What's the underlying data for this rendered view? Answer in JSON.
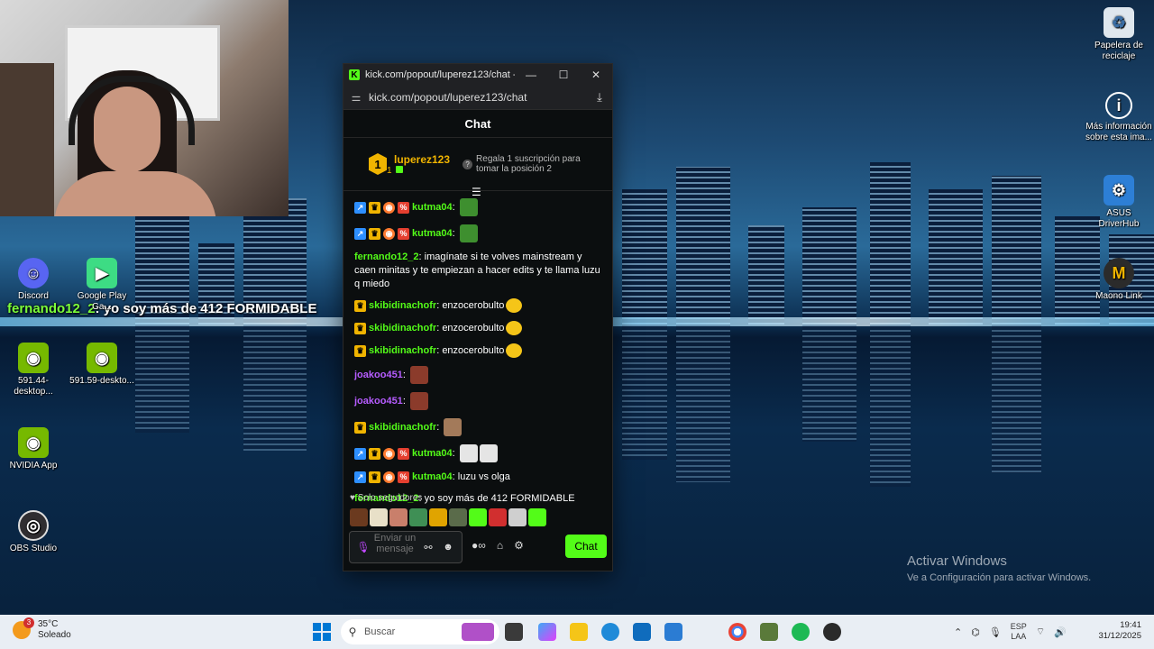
{
  "desktop": {
    "icons": [
      {
        "label": "Papelera de reciclaje",
        "icon": "recycle-bin-icon"
      },
      {
        "label": "Más información sobre esta ima...",
        "icon": "info-icon"
      },
      {
        "label": "ASUS DriverHub",
        "icon": "asus-icon"
      },
      {
        "label": "Maono Link",
        "icon": "maono-icon"
      },
      {
        "label": "Discord",
        "icon": "discord-icon"
      },
      {
        "label": "Google Play Ga...",
        "icon": "google-play-icon"
      },
      {
        "label": "591.44-desktop...",
        "icon": "nvidia-installer-icon"
      },
      {
        "label": "591.59-deskto...",
        "icon": "nvidia-installer-icon"
      },
      {
        "label": "NVIDIA App",
        "icon": "nvidia-icon"
      },
      {
        "label": "OBS Studio",
        "icon": "obs-icon"
      }
    ],
    "overlay": {
      "name": "fernando12_2",
      "text": ": yo soy más de 412 FORMIDABLE"
    },
    "activate": {
      "title": "Activar Windows",
      "subtitle": "Ve a Configuración para activar Windows."
    }
  },
  "window": {
    "title": "kick.com/popout/luperez123/chat - G...",
    "url": "kick.com/popout/luperez123/chat",
    "chat_header": "Chat",
    "pinned": {
      "rank": "1",
      "user": "luperez123",
      "count": "1",
      "info": "Regala 1 suscripción para tomar la posición 2"
    },
    "messages": [
      {
        "badges": [
          "mod",
          "vip",
          "og",
          "sub"
        ],
        "user": "kutma04",
        "color": "#53fc18",
        "text": "",
        "emotes": [
          "e-green"
        ]
      },
      {
        "badges": [
          "mod",
          "vip",
          "og",
          "sub"
        ],
        "user": "kutma04",
        "color": "#53fc18",
        "text": "",
        "emotes": [
          "e-green"
        ]
      },
      {
        "badges": [],
        "user": "fernando12_2",
        "color": "#53fc18",
        "text": "imagínate si te volves mainstream y caen minitas y te empiezan a hacer edits y te llama luzu q miedo",
        "emotes": [],
        "multi": true
      },
      {
        "badges": [
          "vip"
        ],
        "user": "skibidinachofr",
        "color": "#53fc18",
        "text": "enzocerobulto",
        "emotes": [
          "e-yellow"
        ]
      },
      {
        "badges": [
          "vip"
        ],
        "user": "skibidinachofr",
        "color": "#53fc18",
        "text": "enzocerobulto",
        "emotes": [
          "e-yellow"
        ]
      },
      {
        "badges": [
          "vip"
        ],
        "user": "skibidinachofr",
        "color": "#53fc18",
        "text": "enzocerobulto",
        "emotes": [
          "e-yellow"
        ]
      },
      {
        "badges": [],
        "user": "joakoo451",
        "color": "#b65cff",
        "text": "",
        "emotes": [
          "e-face"
        ]
      },
      {
        "badges": [],
        "user": "joakoo451",
        "color": "#b65cff",
        "text": "",
        "emotes": [
          "e-face"
        ]
      },
      {
        "badges": [
          "vip"
        ],
        "user": "skibidinachofr",
        "color": "#53fc18",
        "text": "",
        "emotes": [
          "e-photo"
        ]
      },
      {
        "badges": [
          "mod",
          "vip",
          "og",
          "sub"
        ],
        "user": "kutma04",
        "color": "#53fc18",
        "text": "",
        "emotes": [
          "e-white",
          "e-white"
        ]
      },
      {
        "badges": [
          "mod",
          "vip",
          "og",
          "sub"
        ],
        "user": "kutma04",
        "color": "#53fc18",
        "text": "luzu vs olga",
        "emotes": []
      },
      {
        "badges": [],
        "user": "fernando12_2",
        "color": "#53fc18",
        "text": "yo soy más de 412 FORMIDABLE",
        "emotes": []
      }
    ],
    "followers_only": "Solo seguidores",
    "emote_bar_colors": [
      "#6b3a1f",
      "#e8e0c8",
      "#c97f6b",
      "#3f8f55",
      "#e0a400",
      "#5a6b4a",
      "#53fc18",
      "#d12f2f",
      "#cfcfcf",
      "#53fc18"
    ],
    "composer": {
      "placeholder": "Enviar un mensaje",
      "send_label": "Chat"
    }
  },
  "taskbar": {
    "weather": {
      "temp": "35°C",
      "condition": "Soleado",
      "badge": "3"
    },
    "search_placeholder": "Buscar",
    "lang": {
      "line1": "ESP",
      "line2": "LAA"
    },
    "time": "19:41",
    "date": "31/12/2025"
  }
}
